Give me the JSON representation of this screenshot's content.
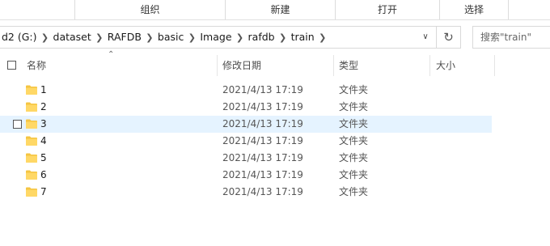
{
  "ribbon": {
    "groups": [
      {
        "label": "组织"
      },
      {
        "label": "新建"
      },
      {
        "label": "打开"
      },
      {
        "label": "选择"
      }
    ]
  },
  "address": {
    "crumbs": [
      "d2 (G:)",
      "dataset",
      "RAFDB",
      "basic",
      "Image",
      "rafdb",
      "train"
    ]
  },
  "search": {
    "placeholder": "搜索\"train\""
  },
  "columns": {
    "name": "名称",
    "date": "修改日期",
    "type": "类型",
    "size": "大小"
  },
  "files": [
    {
      "name": "1",
      "date": "2021/4/13 17:19",
      "type": "文件夹",
      "selected": false
    },
    {
      "name": "2",
      "date": "2021/4/13 17:19",
      "type": "文件夹",
      "selected": false
    },
    {
      "name": "3",
      "date": "2021/4/13 17:19",
      "type": "文件夹",
      "selected": true
    },
    {
      "name": "4",
      "date": "2021/4/13 17:19",
      "type": "文件夹",
      "selected": false
    },
    {
      "name": "5",
      "date": "2021/4/13 17:19",
      "type": "文件夹",
      "selected": false
    },
    {
      "name": "6",
      "date": "2021/4/13 17:19",
      "type": "文件夹",
      "selected": false
    },
    {
      "name": "7",
      "date": "2021/4/13 17:19",
      "type": "文件夹",
      "selected": false
    }
  ],
  "colors": {
    "selected_row": "#e5f3ff",
    "folder": "#f5c542"
  }
}
